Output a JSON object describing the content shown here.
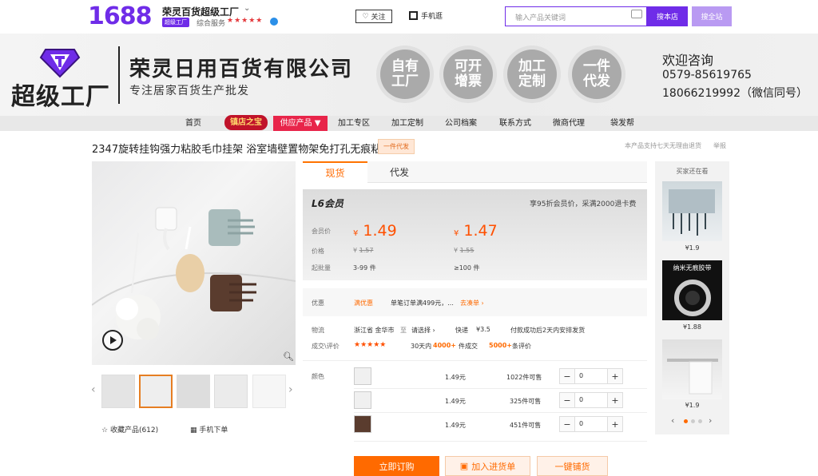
{
  "topbar": {
    "logo": "1688",
    "shop_name": "荣灵百货超级工厂",
    "badge": "超级工厂",
    "service_label": "综合服务",
    "stars": "★★★★★",
    "follow": "关注",
    "mobile_shop": "手机逛",
    "search_placeholder": "输入产品关键词",
    "search_store": "搜本店",
    "search_all": "搜全站"
  },
  "banner": {
    "brand": "超级工厂",
    "company": "荣灵日用百货有限公司",
    "slogan": "专注居家百货生产批发",
    "circles": [
      "自有工厂",
      "可开增票",
      "加工定制",
      "一件代发"
    ],
    "welcome": "欢迎咨询",
    "phone1": "0579-85619765",
    "phone2": "18066219992（微信同号）"
  },
  "nav": {
    "items": [
      "首页",
      "镇店之宝",
      "供应产品 ▼",
      "加工专区",
      "加工定制",
      "公司档案",
      "联系方式",
      "微商代理",
      "袋发帮"
    ]
  },
  "product": {
    "title": "2347旋转挂钩强力粘胶毛巾挂架 浴室墙壁置物架免打孔无痕粘钩",
    "tag": "一件代发",
    "notice": "本产品支持七天无理由退货",
    "report": "举报",
    "favorite": "收藏产品(612)",
    "mobile_order": "手机下单"
  },
  "tabs": [
    "现货",
    "代发"
  ],
  "pricing": {
    "member_level": "L6会员",
    "member_desc": "享95折会员价，采满2000退卡费",
    "row_labels": [
      "会员价",
      "价格",
      "起批量"
    ],
    "currency": "¥",
    "member_prices": [
      "1.49",
      "1.47"
    ],
    "orig_prices": [
      "1.57",
      "1.55"
    ],
    "quantities": [
      "3-99 件",
      "≥100 件"
    ]
  },
  "promo": {
    "label": "优惠",
    "tag": "满优惠",
    "text": "单笔订单满499元，...",
    "link": "去凑单 ›"
  },
  "logistics": {
    "label": "物流",
    "from": "浙江省 金华市",
    "to_word": "至",
    "dest": "请选择 ›",
    "express": "快递",
    "fee": "¥3.5",
    "ship_note": "付款成功后2天内安排发货"
  },
  "reviews": {
    "label": "成交\\评价",
    "stars": "★★★★★",
    "pre": "30天内",
    "count": "4000+",
    "unit": "件成交",
    "review_count": "5000+",
    "review_unit": "条评价"
  },
  "variants": {
    "label": "颜色",
    "rows": [
      {
        "price": "1.49元",
        "stock": "1022件可售",
        "qty": "0"
      },
      {
        "price": "1.49元",
        "stock": "325件可售",
        "qty": "0"
      },
      {
        "price": "1.49元",
        "stock": "451件可售",
        "qty": "0"
      }
    ]
  },
  "actions": {
    "buy": "立即订购",
    "cart": "加入进货单",
    "ship": "一键铺货"
  },
  "rail": {
    "title": "买家还在看",
    "items": [
      {
        "price": "¥1.9"
      },
      {
        "price": "¥1.88",
        "caption": "纳米无痕胶带"
      },
      {
        "price": "¥1.9"
      }
    ]
  },
  "colors": {
    "brand_purple": "#6f2ce8",
    "accent_orange": "#ff6a00",
    "nav_red": "#e8254a"
  }
}
